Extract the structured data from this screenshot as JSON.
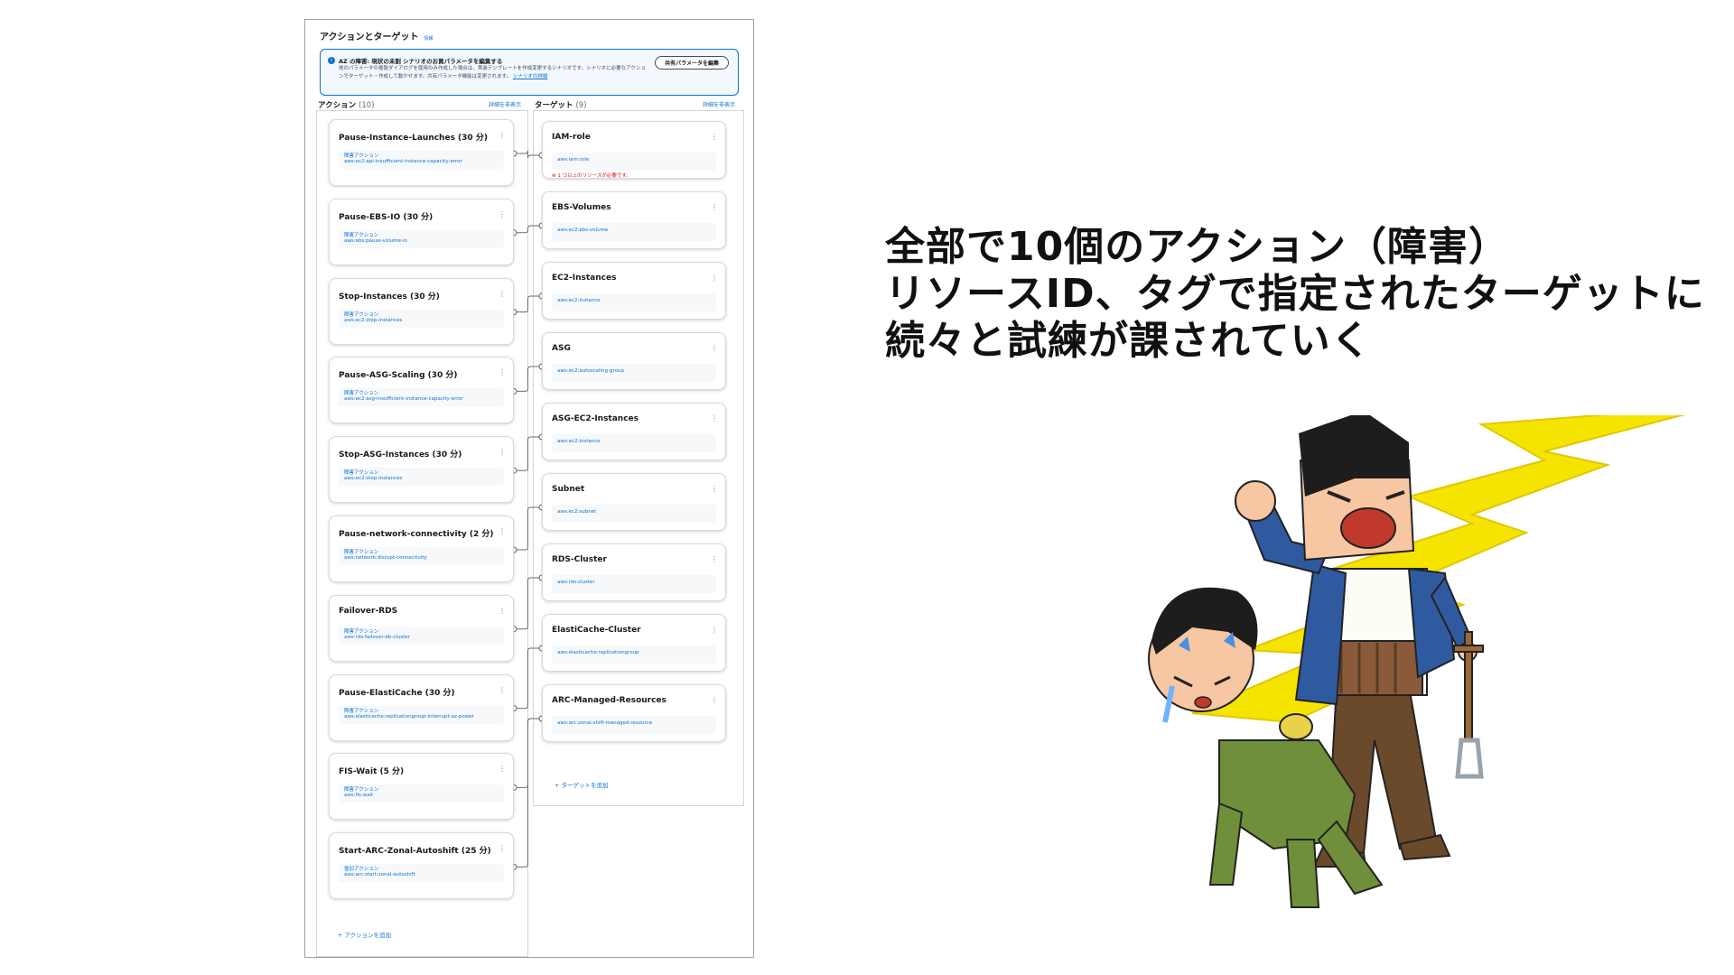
{
  "panel": {
    "title": "アクションとターゲット",
    "info": "情報",
    "alert": {
      "title": "AZ の障害: 現状の未割 シナリオのお買パラメータを編集する",
      "body": "他のパラメータの複製ダイアログを使用のみ作成した場合は、実装テンプレートを作成変更するシナリオです。シナリオに必要なアクションでターゲット・作成して動かせます。共有パラメータ機能は変更されます。",
      "link": "シナリオの詳細",
      "button": "共有パラメータを編集"
    },
    "actions_header": "アクション",
    "actions_count": "(10)",
    "actions_toggle": "詳細を非表示",
    "targets_header": "ターゲット",
    "targets_count": "(9)",
    "targets_toggle": "詳細を非表示",
    "actions": [
      {
        "title": "Pause-Instance-Launches (30 分)",
        "type": "障害アクション",
        "id": "aws:ec2:api-insufficient-instance-capacity-error"
      },
      {
        "title": "Pause-EBS-IO (30 分)",
        "type": "障害アクション",
        "id": "aws:ebs:pause-volume-io"
      },
      {
        "title": "Stop-Instances (30 分)",
        "type": "障害アクション",
        "id": "aws:ec2:stop-instances"
      },
      {
        "title": "Pause-ASG-Scaling (30 分)",
        "type": "障害アクション",
        "id": "aws:ec2:asg-insufficient-instance-capacity-error"
      },
      {
        "title": "Stop-ASG-Instances (30 分)",
        "type": "障害アクション",
        "id": "aws:ec2:stop-instances"
      },
      {
        "title": "Pause-network-connectivity (2 分)",
        "type": "障害アクション",
        "id": "aws:network:disrupt-connectivity"
      },
      {
        "title": "Failover-RDS",
        "type": "障害アクション",
        "id": "aws:rds:failover-db-cluster"
      },
      {
        "title": "Pause-ElastiCache (30 分)",
        "type": "障害アクション",
        "id": "aws:elasticache:replicationgroup-interrupt-az-power"
      },
      {
        "title": "FIS-Wait (5 分)",
        "type": "障害アクション",
        "id": "aws:fis:wait"
      },
      {
        "title": "Start-ARC-Zonal-Autoshift (25 分)",
        "type": "復旧アクション",
        "id": "aws:arc:start-zonal-autoshift"
      }
    ],
    "add_action": "+ アクションを追加",
    "targets": [
      {
        "title": "IAM-role",
        "id": "aws:iam:role",
        "error": "1 つ以上のリソースが必要です。"
      },
      {
        "title": "EBS-Volumes",
        "id": "aws:ec2:ebs-volume"
      },
      {
        "title": "EC2-Instances",
        "id": "aws:ec2:instance"
      },
      {
        "title": "ASG",
        "id": "aws:ec2:autoscaling-group"
      },
      {
        "title": "ASG-EC2-Instances",
        "id": "aws:ec2:instance"
      },
      {
        "title": "Subnet",
        "id": "aws:ec2:subnet"
      },
      {
        "title": "RDS-Cluster",
        "id": "aws:rds:cluster"
      },
      {
        "title": "ElastiCache-Cluster",
        "id": "aws:elasticache:replicationgroup"
      },
      {
        "title": "ARC-Managed-Resources",
        "id": "aws:arc:zonal-shift-managed-resource"
      }
    ],
    "add_target": "+ ターゲットを追加"
  },
  "heading": {
    "line1": "全部で10個のアクション（障害）",
    "line2": "リソースID、タグで指定されたターゲットに",
    "line3": "続々と試練が課されていく"
  },
  "colors": {
    "link": "#0972d3",
    "error": "#d91515",
    "bolt": "#f5e400"
  }
}
